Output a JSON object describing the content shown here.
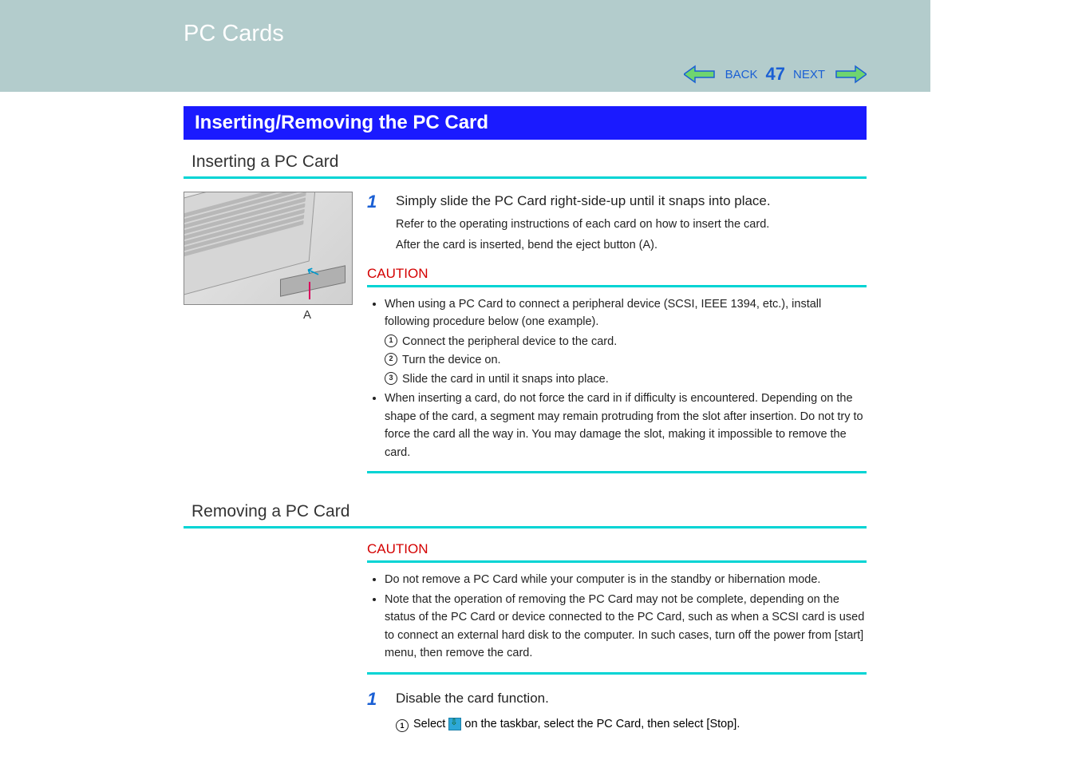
{
  "header": {
    "title": "PC Cards",
    "nav": {
      "back_label": "BACK",
      "page_number": "47",
      "next_label": "NEXT"
    }
  },
  "section": {
    "banner": "Inserting/Removing the PC Card",
    "inserting": {
      "title": "Inserting a PC Card",
      "illustration_label": "A",
      "step1_num": "1",
      "step1_text": "Simply slide the PC Card right-side-up until it snaps into place.",
      "step1_sub1": "Refer to the operating instructions of each card on how to insert the card.",
      "step1_sub2": "After the card is inserted, bend the eject button (A).",
      "caution_label": "CAUTION",
      "caution": {
        "b1": "When using a PC Card to connect a peripheral device (SCSI, IEEE 1394, etc.), install following procedure below (one example).",
        "s1": "Connect the peripheral device to the card.",
        "s2": "Turn the device on.",
        "s3": "Slide the card in until it snaps into place.",
        "b2": "When inserting a card, do not force the card in if difficulty is encountered. Depending on the shape of the card, a segment may remain protruding from the slot after insertion.  Do not try to force the card all the way in.  You may damage the slot, making it impossible to remove the card."
      }
    },
    "removing": {
      "title": "Removing a PC Card",
      "caution_label": "CAUTION",
      "caution": {
        "b1": "Do not remove a PC Card while your computer is in the standby or hibernation mode.",
        "b2": "Note that the operation of removing the PC Card may not be complete, depending on the status of the PC Card or device connected to the PC Card, such as when a SCSI card is used to connect an external hard disk to the computer.  In such cases, turn off the power from [start] menu, then remove the card."
      },
      "step1_num": "1",
      "step1_text": "Disable the card function.",
      "step1_sub_pre": "Select ",
      "step1_sub_post": " on the taskbar, select the PC Card, then select [Stop]."
    }
  },
  "circled": {
    "n1": "1",
    "n2": "2",
    "n3": "3"
  }
}
